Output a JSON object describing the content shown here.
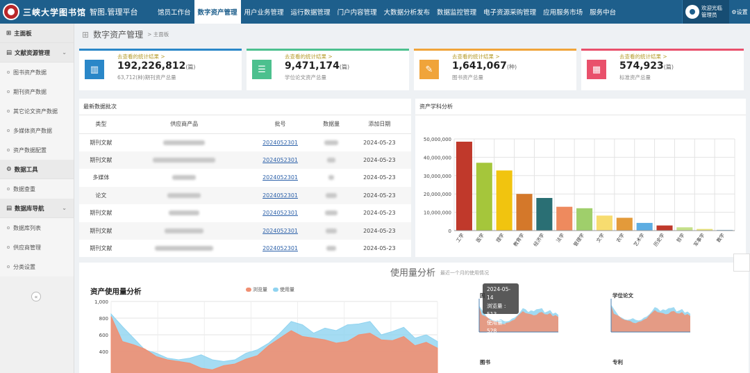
{
  "header": {
    "logo_calligraphy": "三峡大学图书馆",
    "platform_title": "智图.管理平台",
    "nav": [
      "馆员工作台",
      "数字资产管理",
      "用户业务管理",
      "运行数据管理",
      "门户内容管理",
      "大数据分析发布",
      "数据监控管理",
      "电子资源采购管理",
      "应用服务市场",
      "服务中台"
    ],
    "active_nav_index": 1,
    "user_greeting": "欢迎光临",
    "user_role": "管理员",
    "settings_label": "设置"
  },
  "sidebar": {
    "home": "主面板",
    "groups": [
      {
        "label": "文献资源管理",
        "items": [
          "图书资产数据",
          "期刊资产数据",
          "其它论文资产数据",
          "多媒体资产数据",
          "资产数据配置"
        ]
      },
      {
        "label": "数据工具",
        "items": [
          "数据查重"
        ]
      },
      {
        "label": "数据库导航",
        "items": [
          "数据库列表",
          "供应商管理",
          "分类设置"
        ]
      }
    ],
    "collapse_icon": "«"
  },
  "breadcrumb": {
    "title": "数字资产管理",
    "sub": "> 主面板"
  },
  "stats": [
    {
      "link": "去查看的统计结果 >",
      "value": "192,226,812",
      "unit": "(篇)",
      "sub": "63,712(种)期刊资产总量",
      "color": "#2a87c8",
      "icon": "book-icon"
    },
    {
      "link": "去查看的统计结果 >",
      "value": "9,471,174",
      "unit": "(篇)",
      "sub": "学位论文资产总量",
      "color": "#4cc08e",
      "icon": "list-icon"
    },
    {
      "link": "去查看的统计结果 >",
      "value": "1,641,067",
      "unit": "(种)",
      "sub": "图书资产总量",
      "color": "#f0a43a",
      "icon": "edit-icon"
    },
    {
      "link": "去查看的统计结果 >",
      "value": "574,923",
      "unit": "(篇)",
      "sub": "标准资产总量",
      "color": "#e9506b",
      "icon": "chart-icon"
    }
  ],
  "batch_panel": {
    "title": "最新数据批次",
    "headers": [
      "类型",
      "供应商产品",
      "批号",
      "数据量",
      "添加日期"
    ],
    "rows": [
      {
        "type": "期刊文献",
        "batch": "2024052301",
        "date": "2024-05-23"
      },
      {
        "type": "期刊文献",
        "batch": "2024052301",
        "date": "2024-05-23"
      },
      {
        "type": "多媒体",
        "batch": "2024052301",
        "date": "2024-05-23"
      },
      {
        "type": "论文",
        "batch": "2024052301",
        "date": "2024-05-23"
      },
      {
        "type": "期刊文献",
        "batch": "2024052301",
        "date": "2024-05-23"
      },
      {
        "type": "期刊文献",
        "batch": "2024052301",
        "date": "2024-05-23"
      },
      {
        "type": "期刊文献",
        "batch": "2024052301",
        "date": "2024-05-23"
      }
    ]
  },
  "subject_panel": {
    "title": "资产学科分析"
  },
  "usage": {
    "title": "使用量分析",
    "subtitle": "最近一个月的使用情况",
    "chart_title": "资产使用量分析",
    "legend": [
      "浏览量",
      "使用量"
    ],
    "tooltip": {
      "date": "2024-05-14",
      "views": "浏览量 : 513",
      "uses": "使用量 : 528"
    },
    "mini_titles": [
      "学位论文",
      "图书",
      "专利"
    ]
  },
  "chart_data": [
    {
      "type": "bar",
      "title": "资产学科分析",
      "categories": [
        "工学",
        "医学",
        "理学",
        "教育学",
        "经济学",
        "法学",
        "管理学",
        "文学",
        "农学",
        "艺术学",
        "历史学",
        "哲学",
        "军事学",
        "教学"
      ],
      "values": [
        48500000,
        37000000,
        32800000,
        20000000,
        17800000,
        13000000,
        12200000,
        8200000,
        7000000,
        4200000,
        2800000,
        1800000,
        900000,
        400000
      ],
      "colors": [
        "#c0392b",
        "#a5c63b",
        "#f1c40f",
        "#d4782a",
        "#2a6f74",
        "#ee8a5e",
        "#9fcf6b",
        "#f7dc6f",
        "#e39a3a",
        "#5dade2",
        "#c0392b",
        "#c5e08a",
        "#e8e27a",
        "#8ab6d6"
      ],
      "ylim": [
        0,
        50000000
      ],
      "yticks": [
        "0",
        "10,000,000",
        "20,000,000",
        "30,000,000",
        "40,000,000",
        "50,000,000"
      ]
    },
    {
      "type": "area",
      "title": "资产使用量分析",
      "series": [
        {
          "name": "浏览量",
          "color": "#f08f72",
          "values": [
            820,
            520,
            480,
            430,
            340,
            300,
            280,
            260,
            200,
            180,
            230,
            250,
            310,
            350,
            470,
            560,
            650,
            580,
            560,
            540,
            500,
            520,
            600,
            620,
            540,
            530,
            580,
            470,
            510,
            440
          ]
        },
        {
          "name": "使用量",
          "color": "#8fd3f0",
          "values": [
            850,
            700,
            560,
            420,
            380,
            320,
            300,
            320,
            360,
            300,
            280,
            300,
            380,
            420,
            500,
            620,
            760,
            720,
            620,
            680,
            650,
            720,
            730,
            760,
            600,
            640,
            690,
            560,
            600,
            520
          ]
        }
      ],
      "ylim": [
        0,
        1000
      ],
      "yticks": [
        "400",
        "600",
        "800",
        "1,000"
      ]
    }
  ]
}
